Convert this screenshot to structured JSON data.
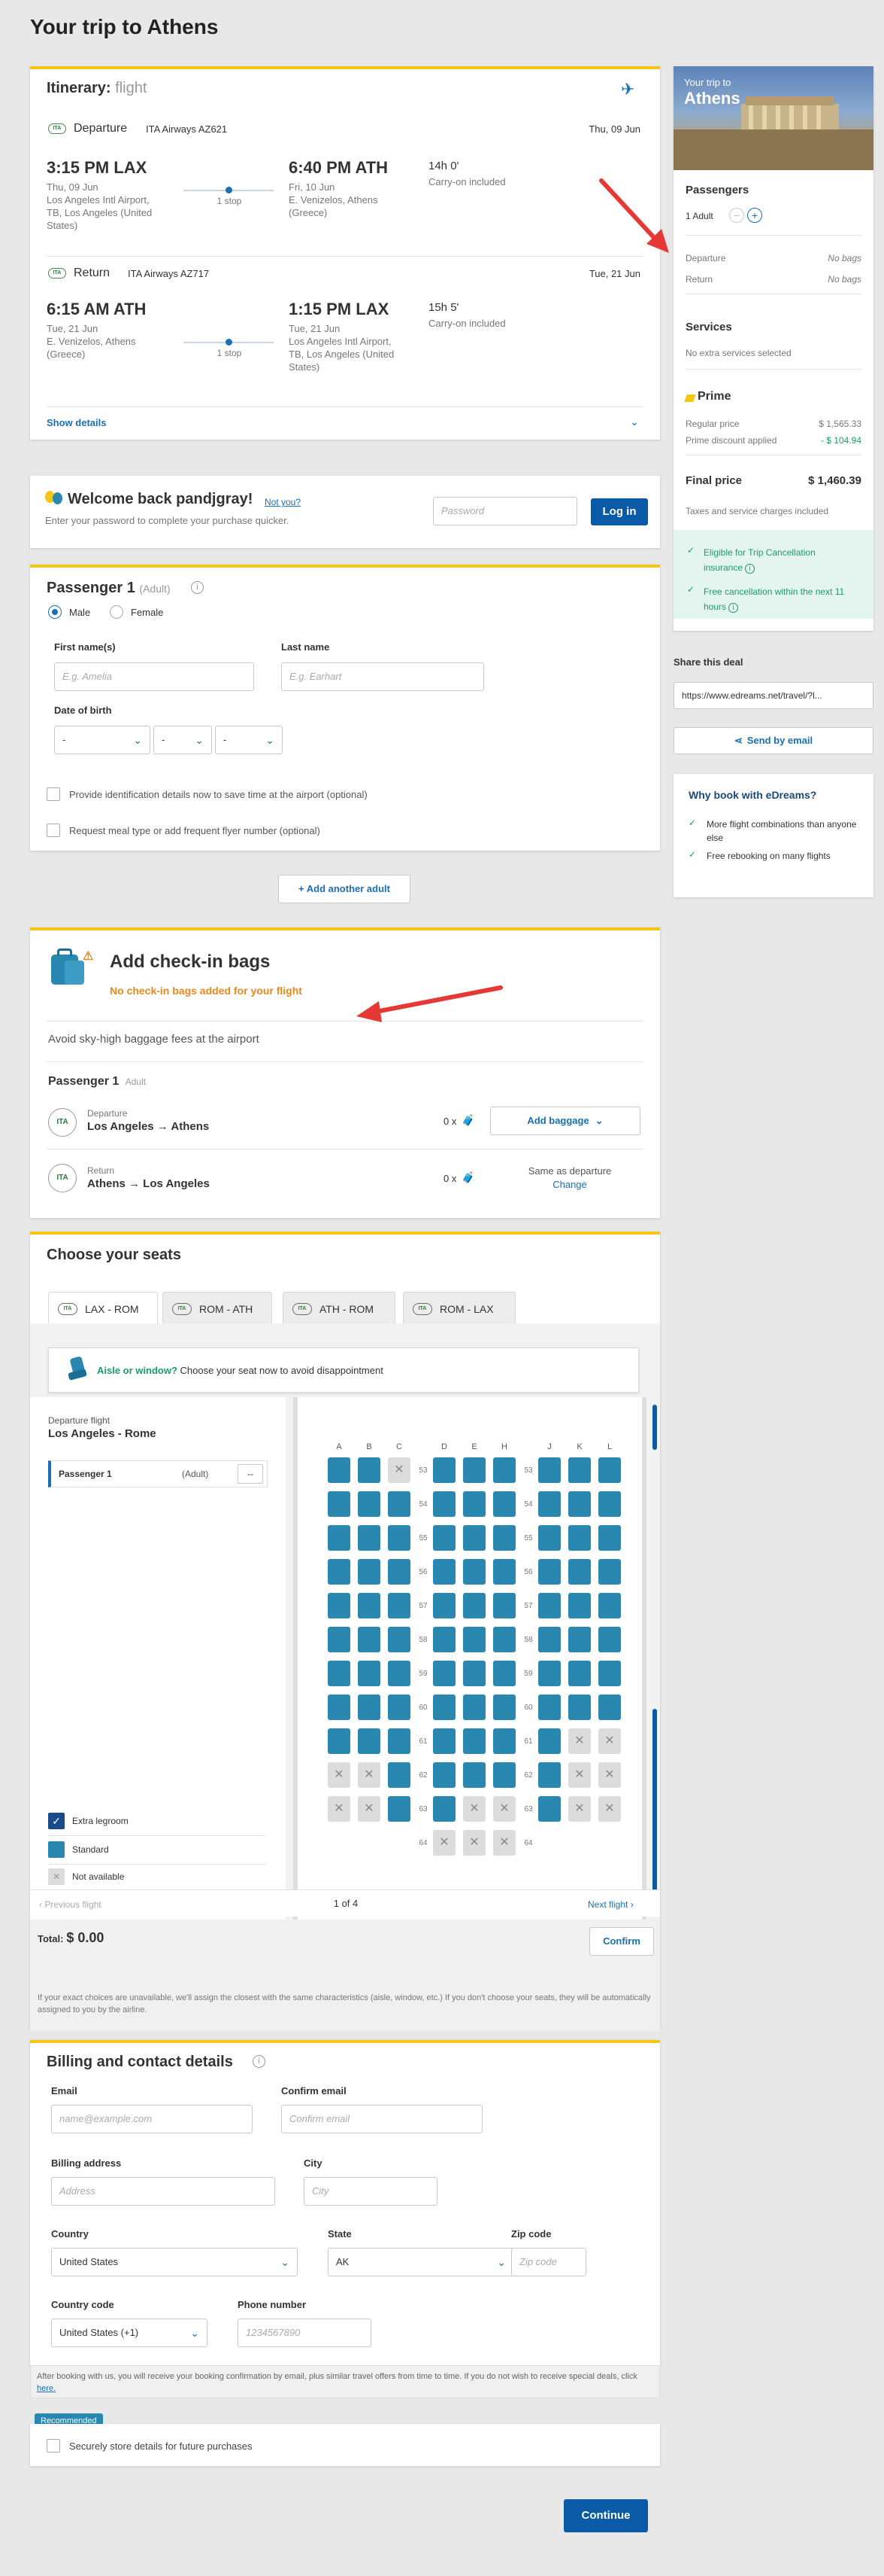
{
  "page_title": "Your trip to Athens",
  "itinerary": {
    "title_bold": "Itinerary:",
    "title_light": "flight",
    "plane_icon": "plane-icon",
    "departure": {
      "label": "Departure",
      "airline": "ITA Airways AZ621",
      "date": "Thu, 09 Jun",
      "dep_time": "3:15 PM LAX",
      "dep_date": "Thu, 09 Jun",
      "dep_airport": "Los Angeles Intl Airport, TB, Los Angeles (United States)",
      "stops": "1 stop",
      "arr_time": "6:40 PM ATH",
      "arr_date": "Fri, 10 Jun",
      "arr_airport": "E. Venizelos, Athens (Greece)",
      "duration": "14h 0'",
      "baggage": "Carry-on included"
    },
    "return": {
      "label": "Return",
      "airline": "ITA Airways AZ717",
      "date": "Tue, 21 Jun",
      "dep_time": "6:15 AM ATH",
      "dep_date": "Tue, 21 Jun",
      "dep_airport": "E. Venizelos, Athens (Greece)",
      "stops": "1 stop",
      "arr_time": "1:15 PM LAX",
      "arr_date": "Tue, 21 Jun",
      "arr_airport": "Los Angeles Intl Airport, TB, Los Angeles (United States)",
      "duration": "15h 5'",
      "baggage": "Carry-on included"
    },
    "show_details": "Show details",
    "airline_logo_text": "ITA"
  },
  "welcome": {
    "title": "Welcome back pandjgray!",
    "not_you": "Not you?",
    "subtitle": "Enter your password to complete your purchase quicker.",
    "password_placeholder": "Password",
    "login": "Log in"
  },
  "passenger": {
    "title": "Passenger 1",
    "type": "(Adult)",
    "male": "Male",
    "female": "Female",
    "first_name_label": "First name(s)",
    "first_name_placeholder": "E.g. Amelia",
    "last_name_label": "Last name",
    "last_name_placeholder": "E.g. Earhart",
    "dob_label": "Date of birth",
    "dob_day": "-",
    "dob_month": "-",
    "dob_year": "-",
    "id_details": "Provide identification details now to save time at the airport (optional)",
    "meal": "Request meal type or add frequent flyer number (optional)",
    "add_adult": "Add another adult"
  },
  "bags": {
    "title": "Add check-in bags",
    "warning": "No check-in bags added for your flight",
    "avoid": "Avoid sky-high baggage fees at the airport",
    "passenger": "Passenger 1",
    "passenger_type": "Adult",
    "departure_label": "Departure",
    "departure_route": "Los Angeles → Athens",
    "departure_count": "0 x",
    "add_baggage": "Add baggage",
    "return_label": "Return",
    "return_route": "Athens → Los Angeles",
    "return_count": "0 x",
    "same_as": "Same as departure",
    "change": "Change"
  },
  "seats": {
    "title": "Choose your seats",
    "tabs": [
      "LAX - ROM",
      "ROM - ATH",
      "ATH - ROM",
      "ROM - LAX"
    ],
    "banner_bold": "Aisle or window?",
    "banner_text": "Choose your seat now to avoid disappointment",
    "flight_label": "Departure flight",
    "flight_route": "Los Angeles - Rome",
    "passenger": "Passenger 1",
    "passenger_type": "(Adult)",
    "passenger_seat": "--",
    "columns_left": [
      "A",
      "B",
      "C"
    ],
    "columns_mid": [
      "D",
      "E",
      "H"
    ],
    "columns_right": [
      "J",
      "K",
      "L"
    ],
    "rows": [
      "53",
      "54",
      "55",
      "56",
      "57",
      "58",
      "59",
      "60",
      "61",
      "62",
      "63",
      "64"
    ],
    "legend_extra": "Extra legroom",
    "legend_standard": "Standard",
    "legend_na": "Not available",
    "prev": "Previous flight",
    "page": "1 of 4",
    "next": "Next flight",
    "total_label": "Total:",
    "total_value": "$ 0.00",
    "confirm": "Confirm",
    "note": "If your exact choices are unavailable, we'll assign the closest with the same characteristics (aisle, window, etc.) If you don't choose your seats, they will be automatically assigned to you by the airline."
  },
  "billing": {
    "title": "Billing and contact details",
    "email_label": "Email",
    "email_placeholder": "name@example.com",
    "confirm_email_label": "Confirm email",
    "confirm_email_placeholder": "Confirm email",
    "address_label": "Billing address",
    "address_placeholder": "Address",
    "city_label": "City",
    "city_placeholder": "City",
    "country_label": "Country",
    "country_value": "United States",
    "state_label": "State",
    "state_value": "AK",
    "zip_label": "Zip code",
    "zip_placeholder": "Zip code",
    "country_code_label": "Country code",
    "country_code_value": "United States (+1)",
    "phone_label": "Phone number",
    "phone_placeholder": "1234567890",
    "notice": "After booking with us, you will receive your booking confirmation by email, plus similar travel offers from time to time. If you do not wish to receive special deals, click",
    "notice_link": "here.",
    "recommended": "Recommended",
    "store": "Securely store details for future purchases",
    "continue": "Continue"
  },
  "sidebar": {
    "hero_small": "Your trip to",
    "hero_big": "Athens",
    "passengers_title": "Passengers",
    "adults": "1 Adult",
    "departure": "Departure",
    "departure_bags": "No bags",
    "return": "Return",
    "return_bags": "No bags",
    "services_title": "Services",
    "services_text": "No extra services selected",
    "prime": "Prime",
    "regular_label": "Regular price",
    "regular_value": "$ 1,565.33",
    "discount_label": "Prime discount applied",
    "discount_value": "- $ 104.94",
    "final_label": "Final price",
    "final_value": "$ 1,460.39",
    "taxes": "Taxes and service charges included",
    "perk1": "Eligible for Trip Cancellation insurance",
    "perk2": "Free cancellation within the next 11 hours",
    "share_title": "Share this deal",
    "share_url": "https://www.edreams.net/travel/?l...",
    "send_email": "Send by email",
    "why_title": "Why book with eDreams?",
    "why1": "More flight combinations than anyone else",
    "why2": "Free rebooking on many flights"
  },
  "colors": {
    "accent_yellow": "#f5c518",
    "primary_blue": "#0b5aa8",
    "seat_blue": "#2a87b0",
    "warning_orange": "#e8891c",
    "green": "#1c9a70",
    "arrow_red": "#e53935"
  }
}
